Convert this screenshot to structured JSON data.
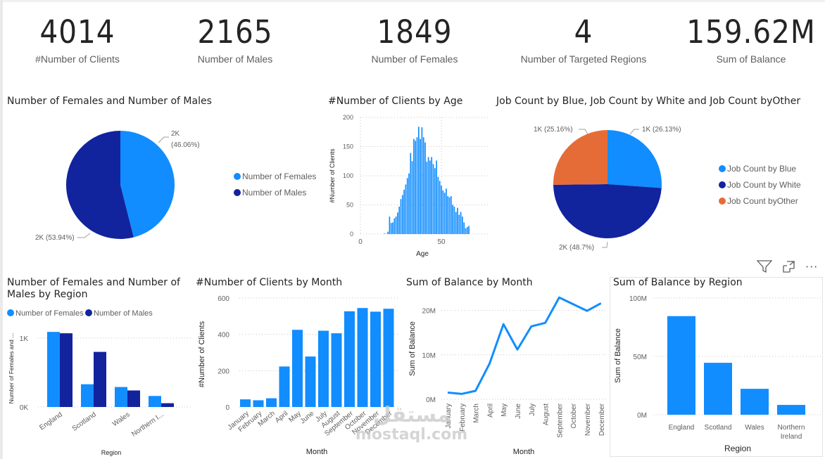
{
  "cards": [
    {
      "value": "4014",
      "label": "#Number of Clients"
    },
    {
      "value": "2165",
      "label": "Number of Males"
    },
    {
      "value": "1849",
      "label": "Number of Females"
    },
    {
      "value": "4",
      "label": "Number of Targeted Regions"
    },
    {
      "value": "159.62M",
      "label": "Sum of Balance"
    }
  ],
  "colors": {
    "light_blue": "#118DFF",
    "dark_blue": "#12239E",
    "orange": "#E66C37",
    "grid": "#c8c6c4",
    "axis_text": "#605e5c"
  },
  "visual_header": {
    "icons": [
      "filter-icon",
      "focus-mode-icon",
      "more-options-icon"
    ],
    "more_label": "···"
  },
  "watermark": {
    "arabic": "مستقل",
    "latin": "mostaql.com"
  },
  "chart_data": [
    {
      "id": "gender_pie",
      "type": "pie",
      "title": "Number of Females and Number of Males",
      "legend_position": "right",
      "slices": [
        {
          "name": "Number of Females",
          "value": 1849,
          "label": "2K (46.06%)",
          "label_line1": "2K",
          "label_line2": "(46.06%)",
          "percent": 46.06,
          "color": "#118DFF"
        },
        {
          "name": "Number of Males",
          "value": 2165,
          "label": "2K (53.94%)",
          "percent": 53.94,
          "color": "#12239E"
        }
      ]
    },
    {
      "id": "age_hist",
      "type": "bar",
      "title": "#Number of Clients by Age",
      "xlabel": "Age",
      "ylabel": "#Number of Clients",
      "xlim": [
        0,
        80
      ],
      "ylim": [
        0,
        200
      ],
      "xticks": [
        0,
        50
      ],
      "yticks": [
        0,
        50,
        100,
        150,
        200
      ],
      "grid": true,
      "x_start": 15,
      "values": [
        1,
        0,
        4,
        30,
        19,
        20,
        27,
        30,
        37,
        47,
        60,
        67,
        76,
        85,
        96,
        104,
        139,
        125,
        163,
        160,
        166,
        184,
        163,
        183,
        166,
        157,
        124,
        132,
        126,
        132,
        120,
        113,
        126,
        98,
        91,
        83,
        75,
        71,
        78,
        65,
        63,
        65,
        50,
        47,
        38,
        45,
        33,
        38,
        30,
        20,
        10,
        12,
        14
      ],
      "color": "#118DFF"
    },
    {
      "id": "job_pie",
      "type": "pie",
      "title": "Job Count by Blue, Job Count by White and Job Count byOther",
      "legend_position": "right",
      "slices": [
        {
          "name": "Job Count by Blue",
          "label": "1K (26.13%)",
          "percent": 26.13,
          "color": "#118DFF"
        },
        {
          "name": "Job Count by White",
          "label": "2K (48.7%)",
          "percent": 48.7,
          "color": "#12239E"
        },
        {
          "name": "Job Count byOther",
          "label": "1K (25.16%)",
          "percent": 25.16,
          "color": "#E66C37"
        }
      ]
    },
    {
      "id": "gender_region",
      "type": "bar",
      "title": "Number of Females and Number of Males by Region",
      "title_line1": "Number of Females and Number of",
      "title_line2": "Males by Region",
      "xlabel": "Region",
      "ylabel": "Number of Females and ...",
      "categories": [
        "England",
        "Scotland",
        "Wales",
        "Northern I..."
      ],
      "series": [
        {
          "name": "Number of Females",
          "values": [
            1090,
            330,
            290,
            160
          ],
          "color": "#118DFF"
        },
        {
          "name": "Number of Males",
          "values": [
            1070,
            800,
            240,
            55
          ],
          "color": "#12239E"
        }
      ],
      "ylim": [
        0,
        1500
      ],
      "yticks": [
        {
          "v": 0,
          "label": "0K"
        },
        {
          "v": 1000,
          "label": "1K"
        }
      ],
      "legend_position": "top-left",
      "grid": true
    },
    {
      "id": "clients_month",
      "type": "bar",
      "title": "#Number of Clients by Month",
      "xlabel": "Month",
      "ylabel": "#Number of Clients",
      "categories": [
        "January",
        "February",
        "March",
        "April",
        "May",
        "June",
        "July",
        "August",
        "September",
        "October",
        "November",
        "December"
      ],
      "values": [
        42,
        37,
        48,
        223,
        425,
        278,
        420,
        406,
        527,
        545,
        525,
        541
      ],
      "ylim": [
        0,
        600
      ],
      "yticks": [
        0,
        200,
        400,
        600
      ],
      "grid": true,
      "color": "#118DFF"
    },
    {
      "id": "balance_month",
      "type": "line",
      "title": "Sum of Balance by Month",
      "xlabel": "Month",
      "ylabel": "Sum of Balance",
      "categories": [
        "January",
        "February",
        "March",
        "April",
        "May",
        "June",
        "July",
        "August",
        "September",
        "October",
        "November",
        "December"
      ],
      "values": [
        1.5,
        1.2,
        1.9,
        8.0,
        16.9,
        11.2,
        16.4,
        17.2,
        22.9,
        21.4,
        19.9,
        21.6
      ],
      "unit": "M",
      "ylim": [
        0,
        25
      ],
      "yticks": [
        {
          "v": 0,
          "label": "0M"
        },
        {
          "v": 10,
          "label": "10M"
        },
        {
          "v": 20,
          "label": "20M"
        }
      ],
      "grid": true,
      "color": "#118DFF"
    },
    {
      "id": "balance_region",
      "type": "bar",
      "title": "Sum of Balance by Region",
      "xlabel": "Region",
      "ylabel": "Sum of Balance",
      "categories": [
        "England",
        "Scotland",
        "Wales",
        "Northern Ireland"
      ],
      "category_lines": [
        [
          "England"
        ],
        [
          "Scotland"
        ],
        [
          "Wales"
        ],
        [
          "Northern",
          "Ireland"
        ]
      ],
      "values": [
        84.5,
        44.5,
        22.2,
        8.4
      ],
      "unit": "M",
      "ylim": [
        0,
        100
      ],
      "yticks": [
        {
          "v": 0,
          "label": "0M"
        },
        {
          "v": 50,
          "label": "50M"
        },
        {
          "v": 100,
          "label": "100M"
        }
      ],
      "grid": true,
      "color": "#118DFF"
    }
  ]
}
